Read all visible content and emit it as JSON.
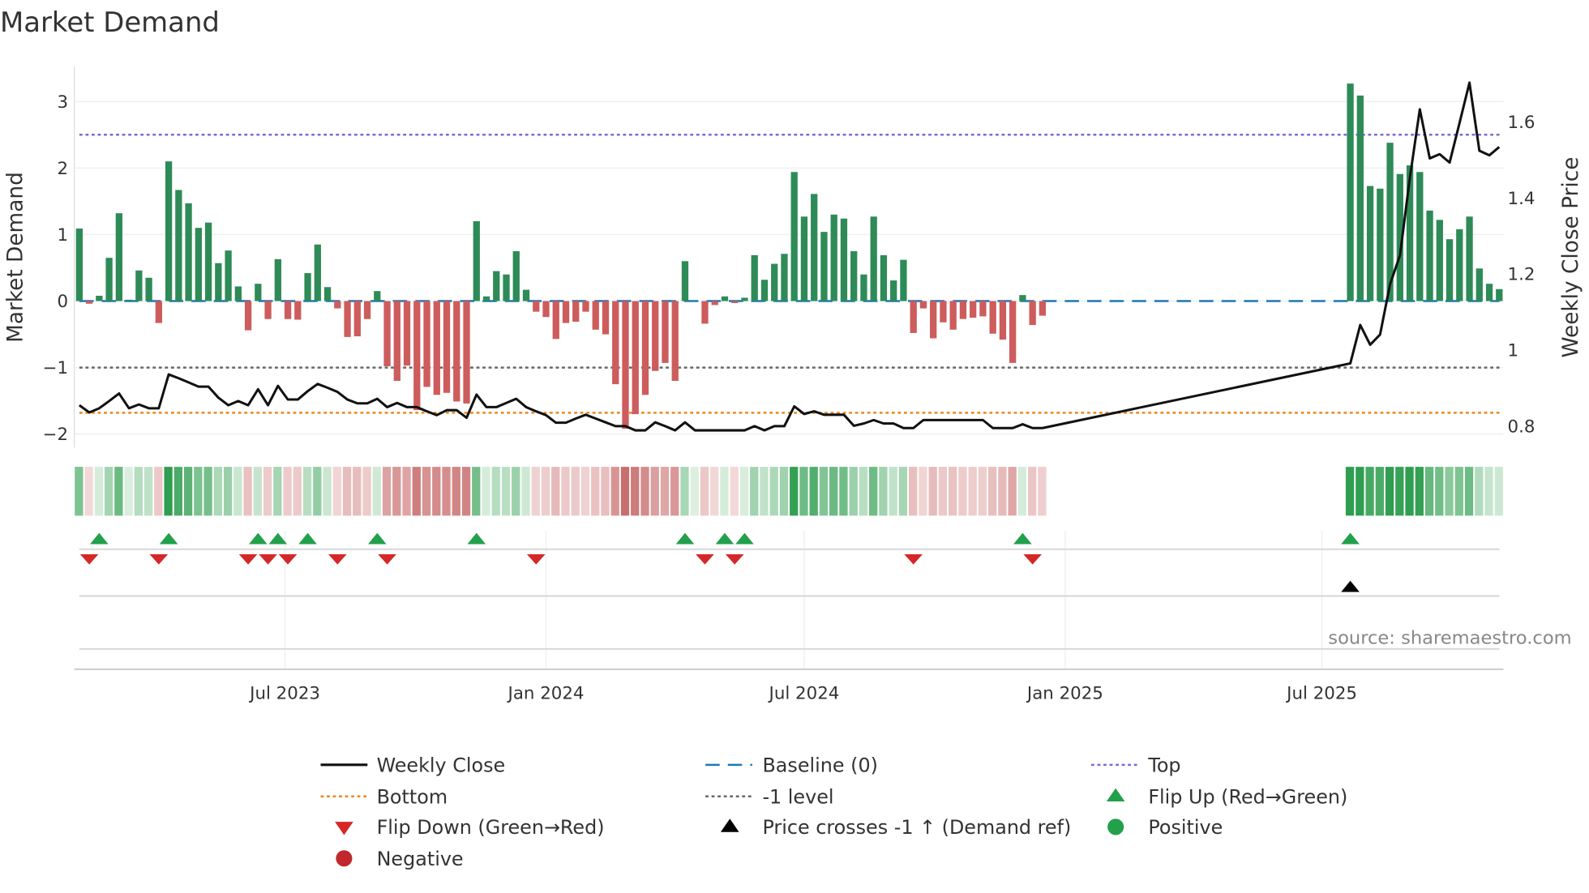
{
  "chart_data": {
    "type": "bar",
    "title": "Market Demand",
    "ylabel": "Market Demand",
    "y2label": "Weekly Close Price",
    "ylim": [
      -2.2,
      3.5
    ],
    "y2lim": [
      0.78,
      1.74
    ],
    "yticks": [
      -2,
      -1,
      0,
      1,
      2,
      3
    ],
    "ytick_labels": [
      "−2",
      "−1",
      "0",
      "1",
      "2",
      "3"
    ],
    "y2ticks": [
      0.8,
      1,
      1.2,
      1.4,
      1.6
    ],
    "y2tick_labels": [
      "0.8",
      "1",
      "1.2",
      "1.4",
      "1.6"
    ],
    "xticks": [
      {
        "date": "2023-07-01",
        "label": "Jul 2023"
      },
      {
        "date": "2024-01-01",
        "label": "Jan 2024"
      },
      {
        "date": "2024-07-01",
        "label": "Jul 2024"
      },
      {
        "date": "2025-01-01",
        "label": "Jan 2025"
      },
      {
        "date": "2025-07-01",
        "label": "Jul 2025"
      }
    ],
    "levels": {
      "top": 2.5,
      "baseline": 0,
      "minus_one": -1,
      "bottom": -1.68
    },
    "colors": {
      "positive": "#2e8b57",
      "negative": "#cd5c5c",
      "top": "#7b68d6",
      "baseline": "#1f77b4",
      "minus_one": "#666666",
      "bottom": "#e8891c",
      "price": "#111111",
      "flip_up": "#22a04b",
      "flip_down": "#d62728",
      "cross": "#000000"
    },
    "segments": [
      {
        "start_date": "2023-02-06",
        "demand": [
          1.09,
          -0.04,
          0.08,
          0.65,
          1.32,
          0.02,
          0.46,
          0.35,
          -0.33,
          2.1,
          1.67,
          1.47,
          1.1,
          1.18,
          0.57,
          0.76,
          0.22,
          -0.44,
          0.26,
          -0.27,
          0.63,
          -0.27,
          -0.28,
          0.42,
          0.85,
          0.21,
          -0.11,
          -0.54,
          -0.53,
          -0.27,
          0.15,
          -0.98,
          -1.2,
          -0.97,
          -1.64,
          -1.29,
          -1.41,
          -1.38,
          -1.51,
          -1.54,
          1.2,
          0.07,
          0.45,
          0.4,
          0.75,
          0.17,
          -0.16,
          -0.24,
          -0.57,
          -0.33,
          -0.31,
          -0.16,
          -0.43,
          -0.5,
          -1.25,
          -1.92,
          -1.7,
          -1.41,
          -1.05,
          -0.93,
          -1.2,
          0.6,
          0,
          -0.34,
          -0.06,
          0.07,
          -0.03,
          0.05,
          0.69,
          0.32,
          0.56,
          0.71,
          1.94,
          1.27,
          1.61,
          1.04,
          1.3,
          1.24,
          0.75,
          0.4,
          1.27,
          0.69,
          0.31,
          0.62,
          -0.48,
          -0.11,
          -0.56,
          -0.32,
          -0.43,
          -0.27,
          -0.25,
          -0.23,
          -0.49,
          -0.58,
          -0.93,
          0.09,
          -0.36,
          -0.22
        ],
        "close": [
          0.855,
          0.836,
          0.847,
          0.866,
          0.886,
          0.847,
          0.857,
          0.847,
          0.847,
          0.936,
          0.926,
          0.915,
          0.904,
          0.904,
          0.875,
          0.855,
          0.866,
          0.855,
          0.897,
          0.855,
          0.906,
          0.87,
          0.87,
          0.892,
          0.911,
          0.901,
          0.89,
          0.87,
          0.86,
          0.86,
          0.872,
          0.85,
          0.861,
          0.85,
          0.85,
          0.839,
          0.829,
          0.842,
          0.842,
          0.822,
          0.883,
          0.85,
          0.85,
          0.861,
          0.872,
          0.85,
          0.839,
          0.829,
          0.809,
          0.809,
          0.82,
          0.83,
          0.82,
          0.81,
          0.8,
          0.8,
          0.789,
          0.789,
          0.81,
          0.8,
          0.789,
          0.81,
          0.789,
          0.789,
          0.789,
          0.789,
          0.789,
          0.789,
          0.8,
          0.789,
          0.8,
          0.8,
          0.852,
          0.832,
          0.839,
          0.83,
          0.83,
          0.83,
          0.801,
          0.807,
          0.816,
          0.807,
          0.807,
          0.795,
          0.795,
          0.816,
          0.816,
          0.816,
          0.816,
          0.816,
          0.816,
          0.816,
          0.795,
          0.795,
          0.795,
          0.805,
          0.795,
          0.795
        ]
      },
      {
        "start_date": "2025-07-21",
        "demand": [
          3.27,
          3.09,
          1.73,
          1.69,
          2.38,
          1.91,
          2.04,
          1.94,
          1.36,
          1.22,
          0.93,
          1.08,
          1.27,
          0.49,
          0.26,
          0.18
        ],
        "close": [
          0.965,
          1.066,
          1.014,
          1.041,
          1.173,
          1.249,
          1.453,
          1.633,
          1.504,
          1.515,
          1.493,
          1.597,
          1.703,
          1.524,
          1.512,
          1.534
        ]
      }
    ],
    "price_cross_events": [
      {
        "segment": 1,
        "index": 0
      }
    ],
    "legend": [
      {
        "key": "weekly_close",
        "label": "Weekly Close"
      },
      {
        "key": "baseline",
        "label": "Baseline (0)"
      },
      {
        "key": "top",
        "label": "Top"
      },
      {
        "key": "bottom",
        "label": "Bottom"
      },
      {
        "key": "minus_one",
        "label": "-1 level"
      },
      {
        "key": "flip_up",
        "label": "Flip Up (Red→Green)"
      },
      {
        "key": "flip_down",
        "label": "Flip Down (Green→Red)"
      },
      {
        "key": "cross",
        "label": "Price crosses -1 ↑ (Demand ref)"
      },
      {
        "key": "positive",
        "label": "Positive"
      },
      {
        "key": "negative",
        "label": "Negative"
      }
    ],
    "legend_placement": "bottom-center",
    "source": "source: sharemaestro.com"
  }
}
